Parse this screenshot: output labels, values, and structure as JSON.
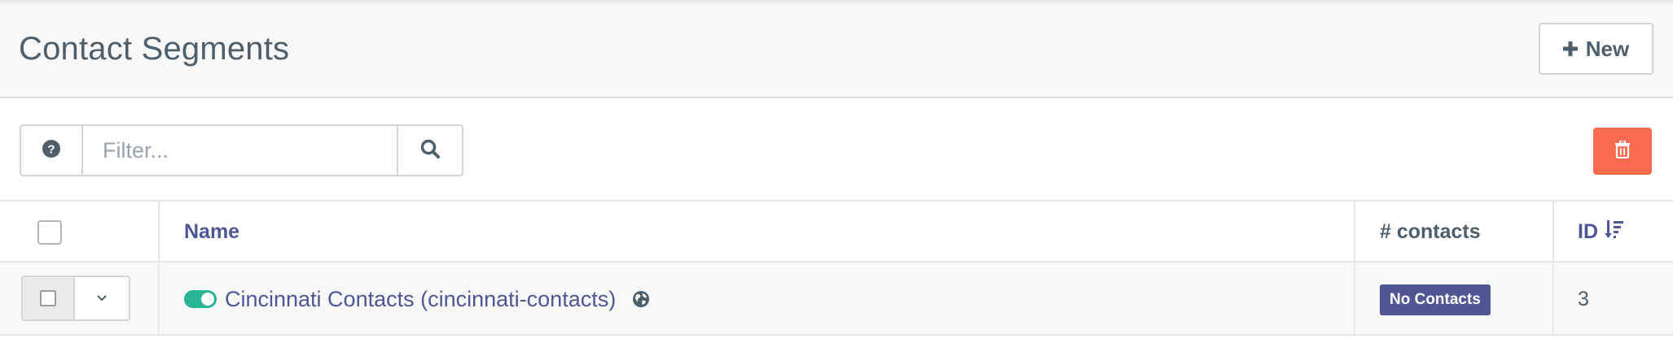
{
  "header": {
    "title": "Contact Segments",
    "new_button": {
      "label": "New",
      "icon": "plus-icon"
    }
  },
  "toolbar": {
    "help_icon": "question-circle-icon",
    "filter": {
      "placeholder": "Filter...",
      "value": ""
    },
    "search_icon": "search-icon",
    "delete_icon": "trash-icon",
    "delete_color": "#f86b4f"
  },
  "table": {
    "columns": {
      "name": "Name",
      "contacts": "# contacts",
      "id": "ID",
      "id_sort_icon": "sort-amount-down-icon"
    },
    "rows": [
      {
        "published": true,
        "name": "Cincinnati Contacts (cincinnati-contacts)",
        "global_icon": "globe-icon",
        "contacts_badge": "No Contacts",
        "id": "3"
      }
    ]
  },
  "colors": {
    "accent": "#4e5694",
    "toggle_on": "#26b494",
    "text": "#4e5e6a"
  }
}
